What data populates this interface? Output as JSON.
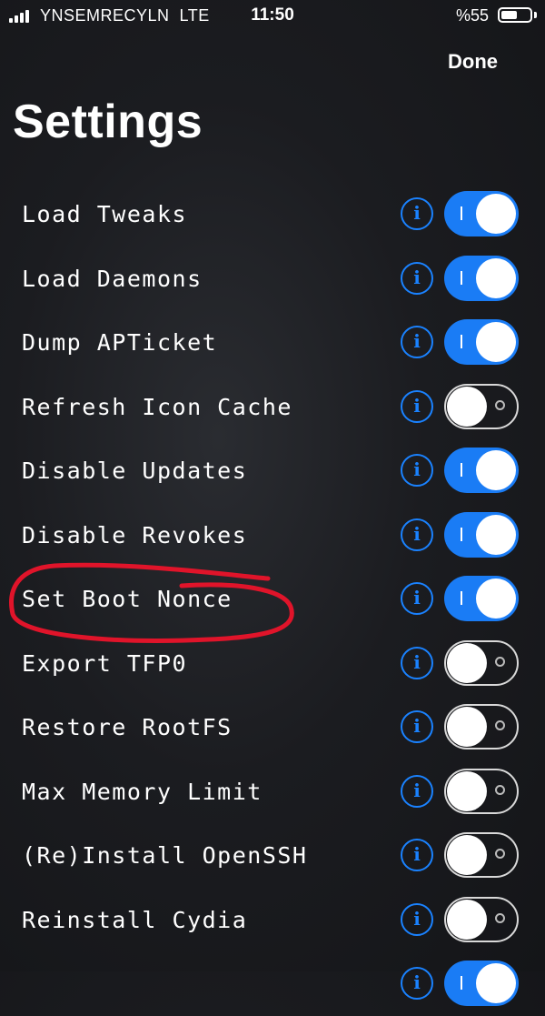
{
  "status_bar": {
    "carrier": "YNSEMRECYLN",
    "network": "LTE",
    "time": "11:50",
    "battery": "%55",
    "battery_level": 0.55,
    "signal_bars": 4
  },
  "nav": {
    "done_label": "Done"
  },
  "title": "Settings",
  "settings": [
    {
      "label": "Load Tweaks",
      "on": true
    },
    {
      "label": "Load Daemons",
      "on": true
    },
    {
      "label": "Dump APTicket",
      "on": true
    },
    {
      "label": "Refresh Icon Cache",
      "on": false
    },
    {
      "label": "Disable Updates",
      "on": true
    },
    {
      "label": "Disable Revokes",
      "on": true
    },
    {
      "label": "Set Boot Nonce",
      "on": true
    },
    {
      "label": "Export TFP0",
      "on": false
    },
    {
      "label": "Restore RootFS",
      "on": false
    },
    {
      "label": "Max Memory Limit",
      "on": false
    },
    {
      "label": "(Re)Install OpenSSH",
      "on": false
    },
    {
      "label": "Reinstall Cydia",
      "on": false
    },
    {
      "label": "",
      "on": true
    }
  ],
  "icons": {
    "info": "info-icon",
    "info_glyph": "i"
  },
  "colors": {
    "accent": "#1a7cf5",
    "annotation": "#e0142a"
  }
}
